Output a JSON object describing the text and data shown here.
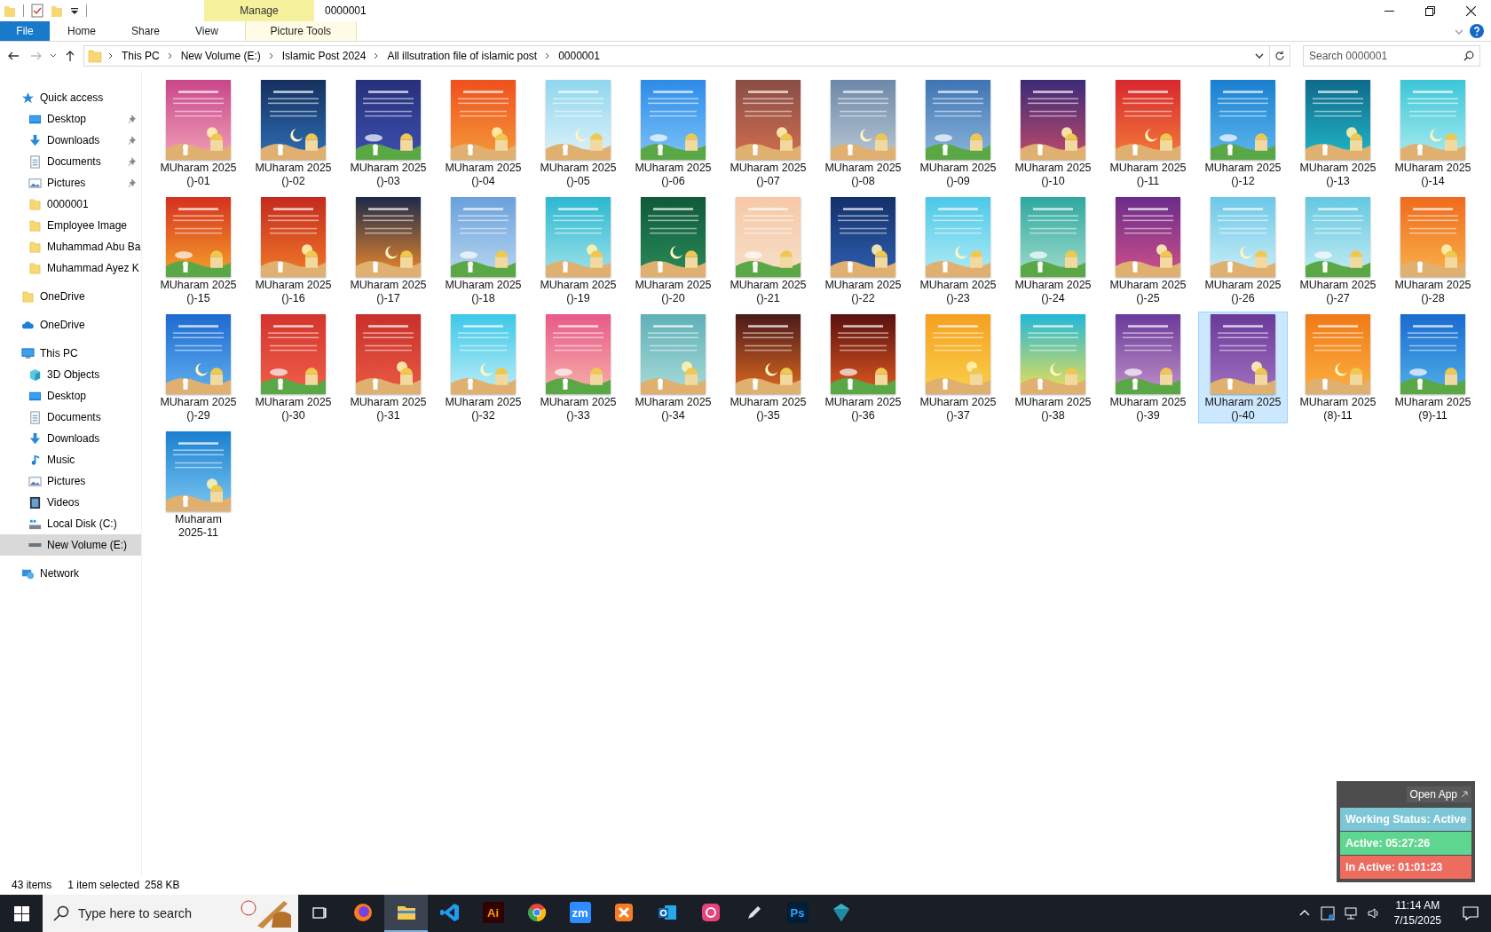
{
  "window": {
    "title": "0000001",
    "context_group": "Manage"
  },
  "ribbon": {
    "tabs": [
      {
        "label": "File",
        "kind": "file"
      },
      {
        "label": "Home",
        "kind": "plain"
      },
      {
        "label": "Share",
        "kind": "plain"
      },
      {
        "label": "View",
        "kind": "plain"
      },
      {
        "label": "Picture Tools",
        "kind": "context"
      }
    ]
  },
  "address": {
    "path": [
      "This PC",
      "New Volume (E:)",
      "Islamic Post 2024",
      "All illsutration file of islamic post",
      "0000001"
    ]
  },
  "search": {
    "placeholder": "Search 0000001"
  },
  "sidebar": {
    "items": [
      {
        "label": "Quick access",
        "kind": "star",
        "selected": false,
        "children": [
          {
            "label": "Desktop",
            "kind": "desktop",
            "pinned": true,
            "selected": false
          },
          {
            "label": "Downloads",
            "kind": "downloads",
            "pinned": true,
            "selected": false
          },
          {
            "label": "Documents",
            "kind": "documents",
            "pinned": true,
            "selected": false
          },
          {
            "label": "Pictures",
            "kind": "pictures",
            "pinned": true,
            "selected": false
          },
          {
            "label": "0000001",
            "kind": "folder",
            "pinned": false,
            "selected": false
          },
          {
            "label": "Employee Image",
            "kind": "folder",
            "pinned": false,
            "selected": false
          },
          {
            "label": "Muhammad Abu Ba",
            "kind": "folder",
            "pinned": false,
            "selected": false
          },
          {
            "label": "Muhammad Ayez K",
            "kind": "folder",
            "pinned": false,
            "selected": false
          }
        ]
      },
      {
        "label": "OneDrive",
        "kind": "folder",
        "selected": false
      },
      {
        "label": "OneDrive",
        "kind": "cloud",
        "selected": false
      },
      {
        "label": "This PC",
        "kind": "pc",
        "selected": false,
        "children": [
          {
            "label": "3D Objects",
            "kind": "cube",
            "selected": false
          },
          {
            "label": "Desktop",
            "kind": "desktop",
            "selected": false
          },
          {
            "label": "Documents",
            "kind": "documents",
            "selected": false
          },
          {
            "label": "Downloads",
            "kind": "downloads",
            "selected": false
          },
          {
            "label": "Music",
            "kind": "music",
            "selected": false
          },
          {
            "label": "Pictures",
            "kind": "pictures",
            "selected": false
          },
          {
            "label": "Videos",
            "kind": "videos",
            "selected": false
          },
          {
            "label": "Local Disk (C:)",
            "kind": "disk",
            "selected": false
          },
          {
            "label": "New Volume (E:)",
            "kind": "drive",
            "selected": true
          }
        ]
      },
      {
        "label": "Network",
        "kind": "network",
        "selected": false
      }
    ]
  },
  "files": [
    {
      "name": "MUharam 2025 ()-01",
      "selected": false
    },
    {
      "name": "MUharam 2025 ()-02",
      "selected": false
    },
    {
      "name": "MUharam 2025 ()-03",
      "selected": false
    },
    {
      "name": "MUharam 2025 ()-04",
      "selected": false
    },
    {
      "name": "MUharam 2025 ()-05",
      "selected": false
    },
    {
      "name": "MUharam 2025 ()-06",
      "selected": false
    },
    {
      "name": "MUharam 2025 ()-07",
      "selected": false
    },
    {
      "name": "MUharam 2025 ()-08",
      "selected": false
    },
    {
      "name": "MUharam 2025 ()-09",
      "selected": false
    },
    {
      "name": "MUharam 2025 ()-10",
      "selected": false
    },
    {
      "name": "MUharam 2025 ()-11",
      "selected": false
    },
    {
      "name": "MUharam 2025 ()-12",
      "selected": false
    },
    {
      "name": "MUharam 2025 ()-13",
      "selected": false
    },
    {
      "name": "MUharam 2025 ()-14",
      "selected": false
    },
    {
      "name": "MUharam 2025 ()-15",
      "selected": false
    },
    {
      "name": "MUharam 2025 ()-16",
      "selected": false
    },
    {
      "name": "MUharam 2025 ()-17",
      "selected": false
    },
    {
      "name": "MUharam 2025 ()-18",
      "selected": false
    },
    {
      "name": "MUharam 2025 ()-19",
      "selected": false
    },
    {
      "name": "MUharam 2025 ()-20",
      "selected": false
    },
    {
      "name": "MUharam 2025 ()-21",
      "selected": false
    },
    {
      "name": "MUharam 2025 ()-22",
      "selected": false
    },
    {
      "name": "MUharam 2025 ()-23",
      "selected": false
    },
    {
      "name": "MUharam 2025 ()-24",
      "selected": false
    },
    {
      "name": "MUharam 2025 ()-25",
      "selected": false
    },
    {
      "name": "MUharam 2025 ()-26",
      "selected": false
    },
    {
      "name": "MUharam 2025 ()-27",
      "selected": false
    },
    {
      "name": "MUharam 2025 ()-28",
      "selected": false
    },
    {
      "name": "MUharam 2025 ()-29",
      "selected": false
    },
    {
      "name": "MUharam 2025 ()-30",
      "selected": false
    },
    {
      "name": "MUharam 2025 ()-31",
      "selected": false
    },
    {
      "name": "MUharam 2025 ()-32",
      "selected": false
    },
    {
      "name": "MUharam 2025 ()-33",
      "selected": false
    },
    {
      "name": "MUharam 2025 ()-34",
      "selected": false
    },
    {
      "name": "MUharam 2025 ()-35",
      "selected": false
    },
    {
      "name": "MUharam 2025 ()-36",
      "selected": false
    },
    {
      "name": "MUharam 2025 ()-37",
      "selected": false
    },
    {
      "name": "MUharam 2025 ()-38",
      "selected": false
    },
    {
      "name": "MUharam 2025 ()-39",
      "selected": false
    },
    {
      "name": "MUharam 2025 ()-40",
      "selected": true
    },
    {
      "name": "MUharam 2025 (8)-11",
      "selected": false
    },
    {
      "name": "MUharam 2025 (9)-11",
      "selected": false
    },
    {
      "name": "Muharam 2025-11",
      "selected": false
    }
  ],
  "status_bar": {
    "count": "43 items",
    "selection": "1 item selected",
    "size": "258 KB"
  },
  "taskbar": {
    "search_placeholder": "Type here to search",
    "apps": [
      {
        "kind": "firefox",
        "selected": false
      },
      {
        "kind": "explorer",
        "selected": true
      },
      {
        "kind": "vscode",
        "selected": false
      },
      {
        "kind": "letters",
        "label": "Ai",
        "color": "#330000",
        "selected": false
      },
      {
        "kind": "chrome",
        "selected": false
      },
      {
        "kind": "letters",
        "label": "zm",
        "color": "#2d8cff",
        "selected": false
      },
      {
        "kind": "xampp",
        "selected": false
      },
      {
        "kind": "outlook",
        "selected": false
      },
      {
        "kind": "cloud",
        "selected": false
      },
      {
        "kind": "pen",
        "selected": false
      },
      {
        "kind": "letters",
        "label": "Ps",
        "color": "#001e36",
        "selected": false
      },
      {
        "kind": "gem",
        "selected": false
      }
    ],
    "time": "11:14 AM",
    "date": "7/15/2025"
  },
  "tracker": {
    "link": "Open App",
    "rows": [
      {
        "label": "Working Status: Active",
        "color": "#7cc6d6"
      },
      {
        "label": "Active: 05:27:26",
        "color": "#5fd690"
      },
      {
        "label": "In Active: 01:01:23",
        "color": "#ee6b5f"
      }
    ]
  }
}
